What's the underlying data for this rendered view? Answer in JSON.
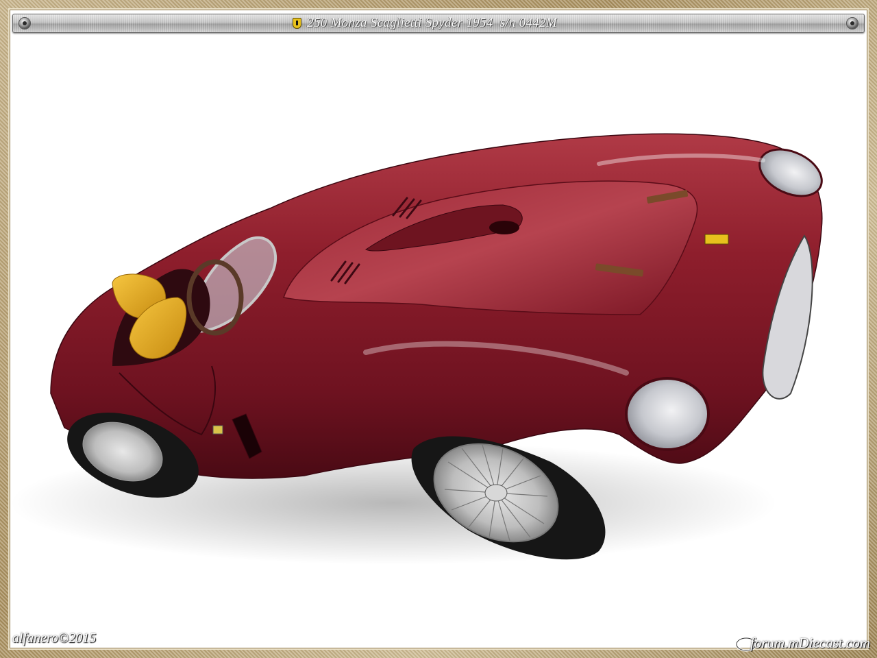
{
  "header": {
    "title": "250 Monza Scaglietti Spyder 1954  s/n 0442M",
    "badge_icon": "prancing-horse-shield-icon"
  },
  "photo": {
    "subject": "",
    "colors": {
      "body": "#8a1a28",
      "seat": "#e8b020",
      "tyre": "#1c1c1c",
      "background": "#ffffff",
      "frame": "#b39c6b"
    }
  },
  "footer": {
    "signature": "alfanero©2015",
    "watermark": "forum.mDiecast.com"
  }
}
